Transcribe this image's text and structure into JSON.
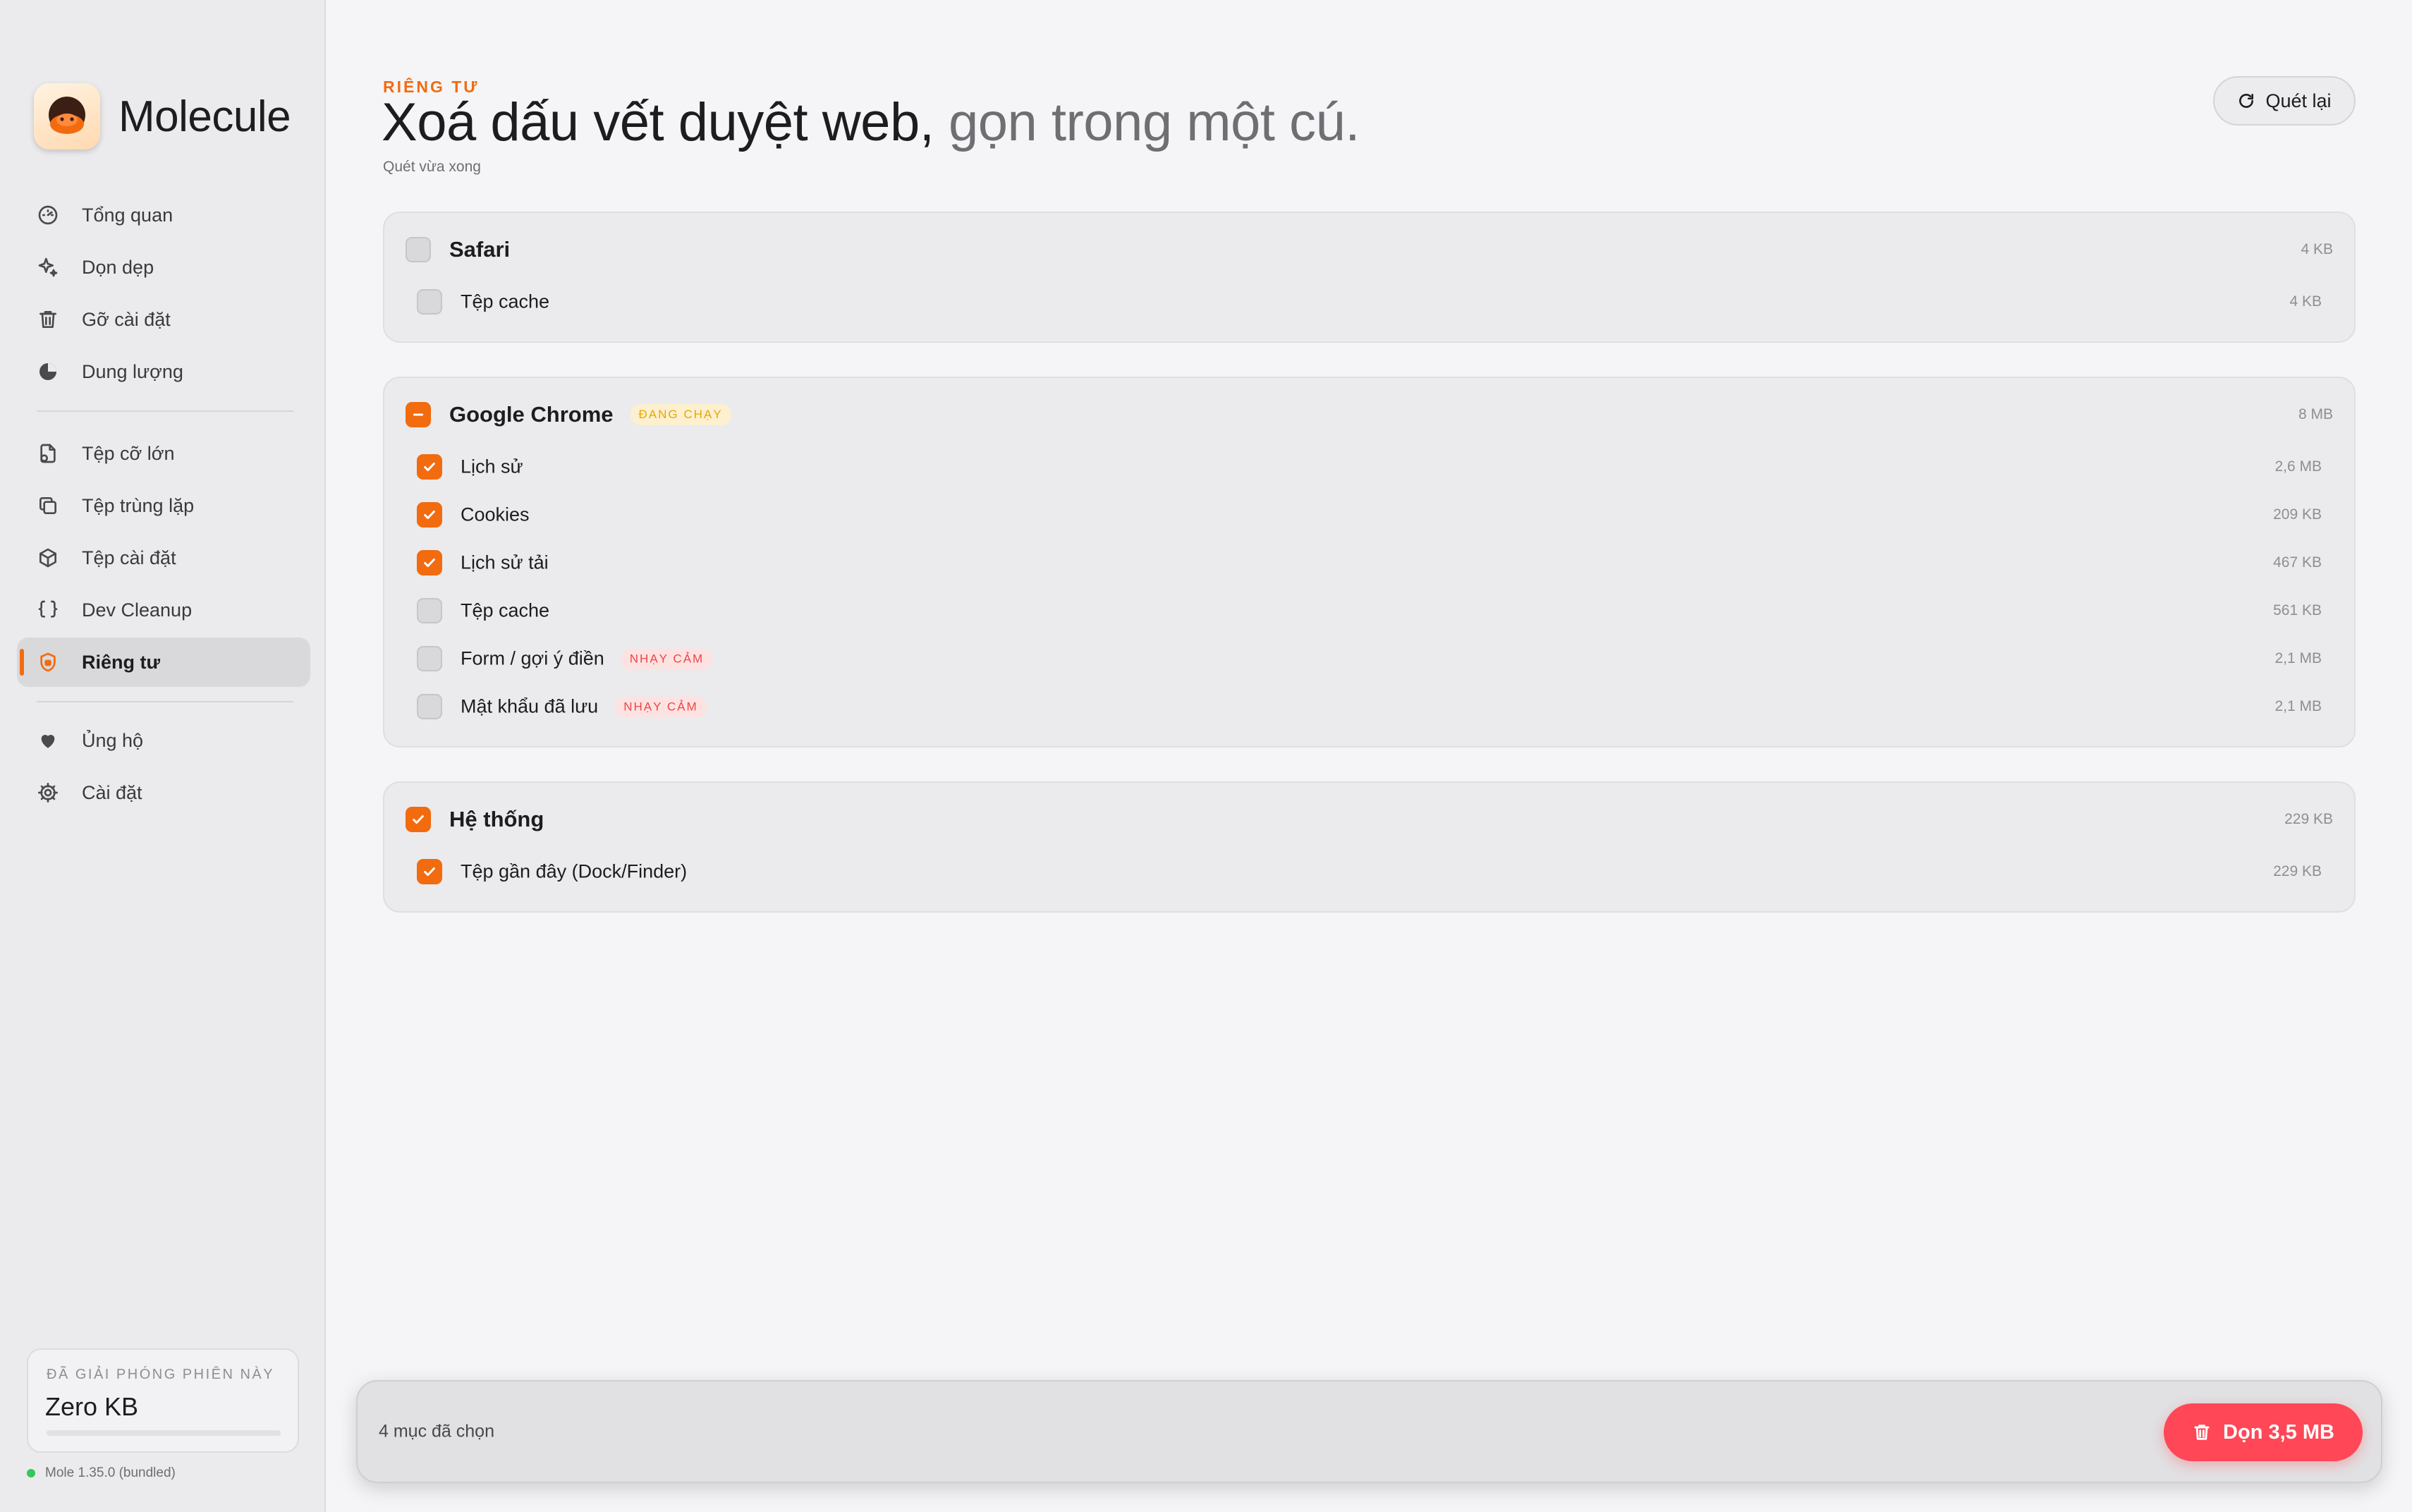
{
  "app": {
    "name": "Molecule",
    "version": "Mole 1.35.0 (bundled)"
  },
  "sidebar": {
    "items_primary": [
      {
        "label": "Tổng quan",
        "icon": "gauge-icon"
      },
      {
        "label": "Dọn dẹp",
        "icon": "sparkle-icon"
      },
      {
        "label": "Gỡ cài đặt",
        "icon": "trash-icon"
      },
      {
        "label": "Dung lượng",
        "icon": "pie-chart-icon"
      }
    ],
    "items_tools": [
      {
        "label": "Tệp cỡ lớn",
        "icon": "large-file-icon"
      },
      {
        "label": "Tệp trùng lặp",
        "icon": "duplicate-icon"
      },
      {
        "label": "Tệp cài đặt",
        "icon": "package-icon"
      },
      {
        "label": "Dev Cleanup",
        "icon": "braces-icon"
      },
      {
        "label": "Riêng tư",
        "icon": "shield-icon",
        "active": true
      }
    ],
    "items_footer": [
      {
        "label": "Ủng hộ",
        "icon": "heart-icon"
      },
      {
        "label": "Cài đặt",
        "icon": "gear-icon"
      }
    ],
    "freed": {
      "caption": "ĐÃ GIẢI PHÓNG PHIÊN NÀY",
      "value": "Zero KB",
      "progress": 0
    }
  },
  "header": {
    "eyebrow": "RIÊNG TƯ",
    "title_main": "Xoá dấu vết duyệt web,",
    "title_accent": " gọn trong một cú.",
    "subtitle": "Quét vừa xong",
    "rescan_label": "Quét lại"
  },
  "groups": [
    {
      "name": "Safari",
      "size": "4 KB",
      "state": "off",
      "badge": "",
      "items": [
        {
          "label": "Tệp cache",
          "size": "4 KB",
          "checked": false,
          "badge": ""
        }
      ]
    },
    {
      "name": "Google Chrome",
      "size": "8 MB",
      "state": "mixed",
      "badge": "ĐANG CHẠY",
      "items": [
        {
          "label": "Lịch sử",
          "size": "2,6 MB",
          "checked": true,
          "badge": ""
        },
        {
          "label": "Cookies",
          "size": "209 KB",
          "checked": true,
          "badge": ""
        },
        {
          "label": "Lịch sử tải",
          "size": "467 KB",
          "checked": true,
          "badge": ""
        },
        {
          "label": "Tệp cache",
          "size": "561 KB",
          "checked": false,
          "badge": ""
        },
        {
          "label": "Form / gợi ý điền",
          "size": "2,1 MB",
          "checked": false,
          "badge": "NHẠY CẢM"
        },
        {
          "label": "Mật khẩu đã lưu",
          "size": "2,1 MB",
          "checked": false,
          "badge": "NHẠY CẢM"
        }
      ]
    },
    {
      "name": "Hệ thống",
      "size": "229 KB",
      "state": "on",
      "badge": "",
      "items": [
        {
          "label": "Tệp gần đây (Dock/Finder)",
          "size": "229 KB",
          "checked": true,
          "badge": ""
        }
      ]
    }
  ],
  "footer": {
    "selected_count": "4 mục đã chọn",
    "clean_label": "Dọn 3,5 MB"
  },
  "colors": {
    "accent": "#f26b0f",
    "danger": "#ff4757",
    "running_badge": "#e6a700",
    "sensitive_badge": "#ef4444",
    "status_dot": "#34c759"
  }
}
